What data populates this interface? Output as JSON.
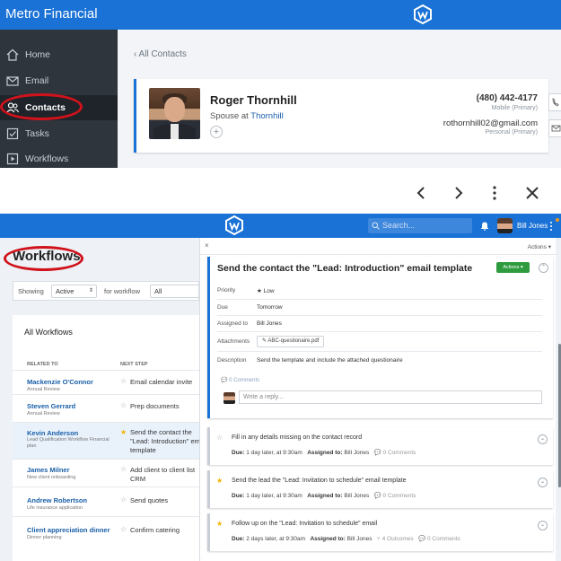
{
  "top": {
    "brand": "Metro Financial",
    "nav": [
      {
        "label": "Home",
        "icon": "home-icon"
      },
      {
        "label": "Email",
        "icon": "mail-icon"
      },
      {
        "label": "Contacts",
        "icon": "contacts-icon"
      },
      {
        "label": "Tasks",
        "icon": "checkbox-icon"
      },
      {
        "label": "Workflows",
        "icon": "play-icon"
      }
    ],
    "breadcrumb": "‹ All Contacts",
    "contact": {
      "name": "Roger Thornhill",
      "relation_prefix": "Spouse at ",
      "relation_company": "Thornhill",
      "phone": "(480) 442-4177",
      "phone_type": "Mobile (Primary)",
      "email": "rothornhill02@gmail.com",
      "email_type": "Personal (Primary)"
    }
  },
  "toolbar": {
    "back": "‹",
    "forward": "›",
    "more": "⋮",
    "close": "✕"
  },
  "bottom": {
    "search_placeholder": "Search...",
    "user_name": "Bill Jones",
    "workflows_title": "Workflows",
    "filter": {
      "showing_label": "Showing",
      "showing_value": "Active",
      "for_label": "for workflow",
      "for_value": "All"
    },
    "table_title": "All Workflows",
    "columns": [
      "RELATED TO",
      "NEXT STEP"
    ],
    "rows": [
      {
        "name": "Mackenzie O'Connor",
        "sub": "Annual Review",
        "step": "Email calendar invite",
        "starred": false
      },
      {
        "name": "Steven Gerrard",
        "sub": "Annual Review",
        "step": "Prep documents",
        "starred": false
      },
      {
        "name": "Kevin Anderson",
        "sub": "Lead Qualification Workflow Financial plan",
        "step": "Send the contact the \"Lead: Introduction\" em template",
        "starred": true
      },
      {
        "name": "James Milner",
        "sub": "New client onboarding",
        "step": "Add client to client list CRM",
        "starred": false
      },
      {
        "name": "Andrew Robertson",
        "sub": "Life insurance application",
        "step": "Send quotes",
        "starred": false
      },
      {
        "name": "Client appreciation dinner",
        "sub": "Dinner planning",
        "step": "Confirm catering",
        "starred": false
      }
    ],
    "detail": {
      "close": "×",
      "actions": "Actions ▾",
      "task_title": "Send the contact the \"Lead: Introduction\" email template",
      "actions_btn": "Actions ▾",
      "fields": [
        {
          "key": "Priority",
          "value": "★ Low"
        },
        {
          "key": "Due",
          "value": "Tomorrow"
        },
        {
          "key": "Assigned to",
          "value": "Bill Jones"
        },
        {
          "key": "Attachments",
          "value": "✎ ABC-questionaire.pdf"
        },
        {
          "key": "Description",
          "value": "Send the template and include the attached questionaire"
        }
      ],
      "comments": "💬 0 Comments",
      "reply_placeholder": "Write a reply...",
      "tasks": [
        {
          "title": "Fill in any details missing on the contact record",
          "due": "1 day later, at 9:30am",
          "assigned": "Bill Jones",
          "extra": "",
          "comments": "💬 0 Comments",
          "starred": false
        },
        {
          "title": "Send the lead the \"Lead: Invitation to schedule\" email template",
          "due": "1 day later, at 9:30am",
          "assigned": "Bill Jones",
          "extra": "",
          "comments": "💬 0 Comments",
          "starred": true
        },
        {
          "title": "Follow up on the \"Lead: Invitation to schedule\" email",
          "due": "2 days later, at 9:30am",
          "assigned": "Bill Jones",
          "extra": "⑂ 4 Outcomes",
          "comments": "💬 0 Comments",
          "starred": true
        }
      ],
      "due_label": "Due:",
      "assigned_label": "Assigned to:"
    }
  }
}
